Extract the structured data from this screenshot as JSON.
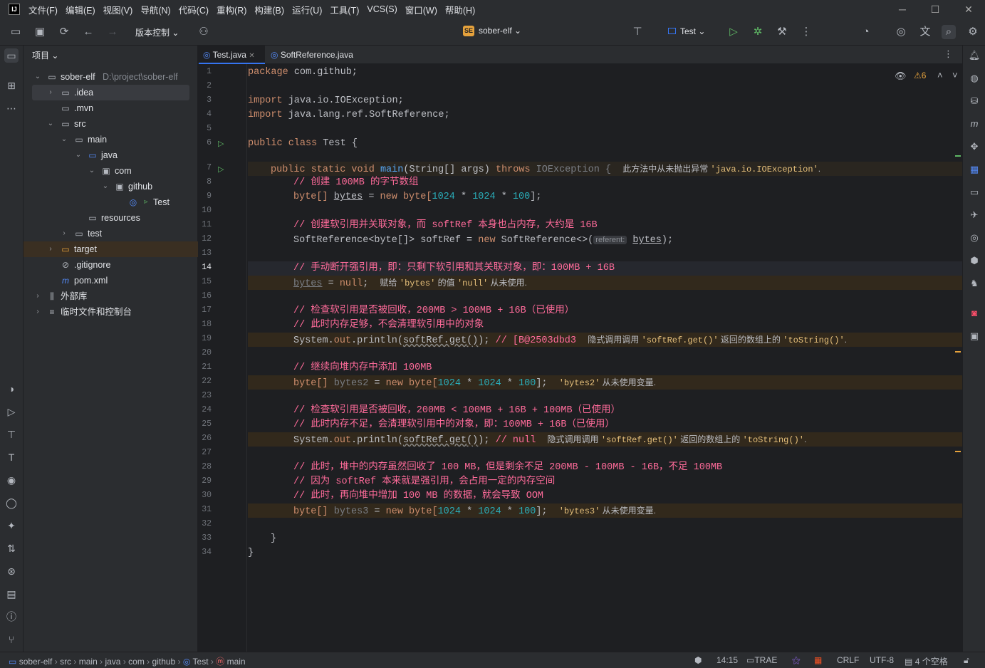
{
  "menu": [
    "文件(F)",
    "编辑(E)",
    "视图(V)",
    "导航(N)",
    "代码(C)",
    "重构(R)",
    "构建(B)",
    "运行(U)",
    "工具(T)",
    "VCS(S)",
    "窗口(W)",
    "帮助(H)"
  ],
  "app_logo": "IJ",
  "toolbar": {
    "vcs_label": "版本控制",
    "project_badge": "SE",
    "project_name": "sober-elf",
    "run_config": "Test"
  },
  "project": {
    "title": "项目",
    "tree": [
      {
        "label": "sober-elf",
        "extra": "D:\\project\\sober-elf"
      },
      {
        "label": ".idea"
      },
      {
        "label": ".mvn"
      },
      {
        "label": "src"
      },
      {
        "label": "main"
      },
      {
        "label": "java"
      },
      {
        "label": "com"
      },
      {
        "label": "github"
      },
      {
        "label": "Test"
      },
      {
        "label": "resources"
      },
      {
        "label": "test"
      },
      {
        "label": "target"
      },
      {
        "label": ".gitignore"
      },
      {
        "label": "pom.xml"
      },
      {
        "label": "外部库"
      },
      {
        "label": "临时文件和控制台"
      }
    ]
  },
  "tabs": [
    {
      "label": "Test.java"
    },
    {
      "label": "SoftReference.java"
    }
  ],
  "inspections": {
    "warnings": "6"
  },
  "code": {
    "line_numbers": [
      "1",
      "2",
      "3",
      "4",
      "5",
      "6",
      "7",
      "8",
      "9",
      "10",
      "11",
      "12",
      "13",
      "14",
      "15",
      "16",
      "17",
      "18",
      "19",
      "20",
      "21",
      "22",
      "23",
      "24",
      "25",
      "26",
      "27",
      "28",
      "29",
      "30",
      "31",
      "32",
      "33",
      "34"
    ],
    "t": {
      "package": "package",
      "pkg_name": " com.github;",
      "import": "import",
      "imp1": " java.io.IOException;",
      "imp2": " java.lang.ref.SoftReference;",
      "public": "public",
      "class": " class",
      "class_name": " Test {",
      "static_void": " static void ",
      "main": "main",
      "params": "(String[] args) ",
      "throws": "throws",
      "ioexc": " IOException {",
      "inl7a": "此方法中从未抛出异常 ",
      "inl7q": "'java.io.IOException'",
      "inl7b": ".",
      "c8": "// 创建 100MB 的字节数组",
      "byte_arr": "byte[] ",
      "bytes": "bytes",
      "eq": " = ",
      "new": "new",
      "byte_open": " byte[",
      "n1024": "1024",
      "times": " * ",
      "n100": "100",
      "close": "];",
      "c11": "// 创建软引用并关联对象，而 softRef 本身也占内存，大约是 16B",
      "sr_decl": "SoftReference<byte[]> softRef = ",
      "sr_new": " SoftReference<>(",
      "hint_referent": "referent:",
      "sr_end": ");",
      "c14": "// 手动断开强引用，即：只剩下软引用和其关联对象，即：100MB + 16B",
      "null": "null",
      "semi": ";",
      "inl15a": "赋给 ",
      "inl15q1": "'bytes'",
      "inl15b": " 的值 ",
      "inl15q2": "'null'",
      "inl15c": " 从未使用.",
      "c17": "// 检查软引用是否被回收，200MB > 100MB + 16B（已使用）",
      "c18": "// 此时内存足够，不会清理软引用中的对象",
      "sys": "System.",
      "out": "out",
      ".println(": ".println(",
      "softref_get": "softRef.get",
      "parens": "()",
      "println_end": "); ",
      "c19tail": "// [B@2503dbd3",
      "inl19a": "隐式调用调用 ",
      "inl19q1": "'softRef.get()'",
      "inl19b": " 返回的数组上的 ",
      "inl19q2": "'toString()'",
      "inl19c": ".",
      "c21": "// 继续向堆内存中添加 100MB",
      "bytes2": "bytes2",
      "inl22q": "'bytes2'",
      "unused": " 从未使用变量.",
      "c24": "// 检查软引用是否被回收，200MB < 100MB + 16B + 100MB（已使用）",
      "c25": "// 此时内存不足，会清理软引用中的对象，即：100MB + 16B（已使用）",
      "c26tail": "// null",
      "c28": "// 此时，堆中的内存虽然回收了 100 MB，但是剩余不足 200MB - 100MB - 16B，不足 100MB",
      "c29": "// 因为 softRef 本来就是强引用，会占用一定的内存空间",
      "c30": "// 此时，再向堆中增加 100 MB 的数据，就会导致 OOM",
      "bytes3": "bytes3",
      "inl31q": "'bytes3'",
      "rbrace": "}"
    }
  },
  "status": {
    "breadcrumbs": [
      "sober-elf",
      "src",
      "main",
      "java",
      "com",
      "github",
      "Test",
      "main"
    ],
    "position": "14:15",
    "trae": "TRAE",
    "line_sep": "CRLF",
    "encoding": "UTF-8",
    "indent": "4 个空格"
  },
  "colors": {
    "keyword": "#cf8e6d",
    "comment": "#ff6b9a",
    "number": "#2aacb8",
    "function": "#56a8f5"
  }
}
